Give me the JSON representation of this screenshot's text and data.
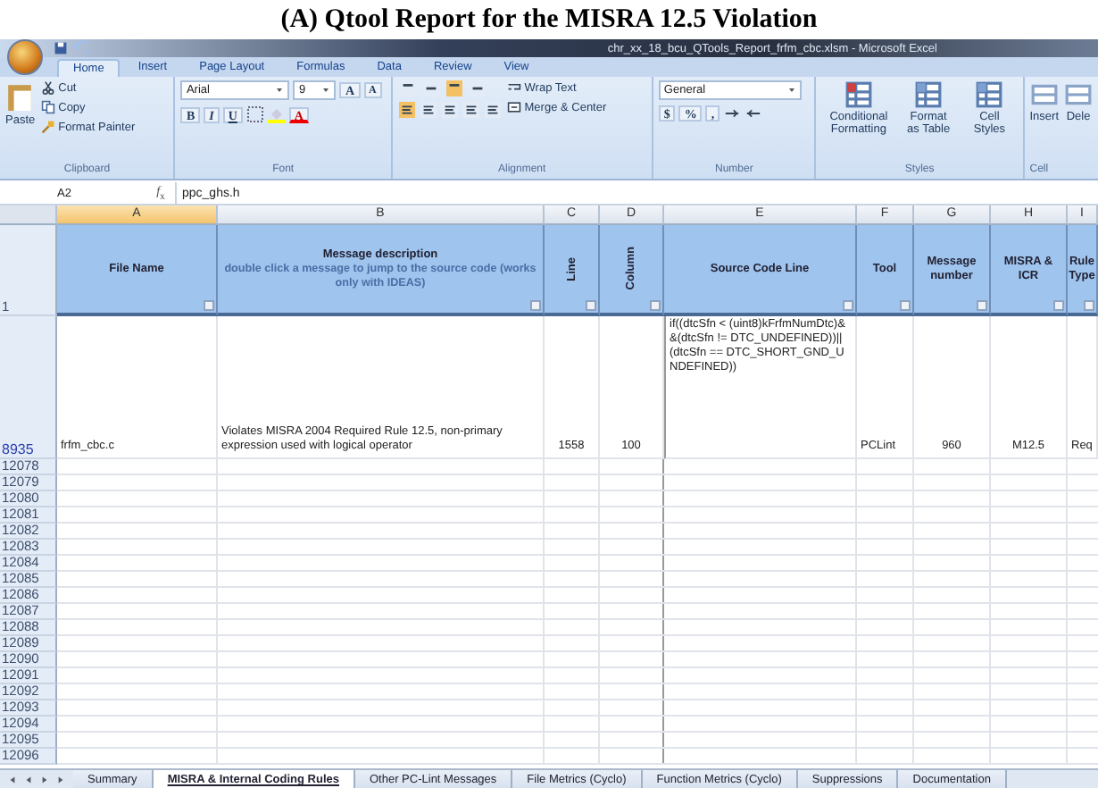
{
  "caption": "(A) Qtool Report for the MISRA 12.5 Violation",
  "window": {
    "title": "chr_xx_18_bcu_QTools_Report_frfm_cbc.xlsm - Microsoft Excel"
  },
  "ribbon": {
    "tabs": [
      {
        "label": "Home",
        "selected": true
      },
      {
        "label": "Insert",
        "selected": false
      },
      {
        "label": "Page Layout",
        "selected": false
      },
      {
        "label": "Formulas",
        "selected": false
      },
      {
        "label": "Data",
        "selected": false
      },
      {
        "label": "Review",
        "selected": false
      },
      {
        "label": "View",
        "selected": false
      }
    ],
    "clipboard": {
      "paste": "Paste",
      "cut": "Cut",
      "copy": "Copy",
      "format_painter": "Format Painter",
      "label": "Clipboard"
    },
    "font": {
      "name": "Arial",
      "size": "9",
      "grow": "A",
      "shrink": "A",
      "styles": [
        "B",
        "I",
        "U"
      ],
      "color_button": "A",
      "label": "Font"
    },
    "alignment": {
      "wrap_text": "Wrap Text",
      "merge": "Merge & Center",
      "label": "Alignment"
    },
    "number": {
      "format": "General",
      "symbols": [
        "$",
        "%",
        ","
      ],
      "label": "Number"
    },
    "styles": {
      "buttons": [
        "Conditional Formatting",
        "Format as Table",
        "Cell Styles"
      ],
      "label": "Styles"
    },
    "cells": {
      "buttons": [
        "Insert",
        "Dele"
      ],
      "label": "Cell"
    }
  },
  "formula_bar": {
    "cell_ref": "A2",
    "fx": "*f*$_{x}$",
    "value": "ppc_ghs.h"
  },
  "sheet": {
    "header_row": "1",
    "columns": [
      {
        "letter": "A",
        "heading": "File Name",
        "selected": true,
        "kind": "plain",
        "centered": false
      },
      {
        "letter": "B",
        "heading": "Message description",
        "note": "double click a message to jump to the source code (works only with IDEAS)",
        "selected": false,
        "kind": "plain",
        "centered": false
      },
      {
        "letter": "C",
        "heading": "Line",
        "selected": false,
        "kind": "vertical",
        "centered": true
      },
      {
        "letter": "D",
        "heading": "Column",
        "selected": false,
        "kind": "vertical",
        "centered": true
      },
      {
        "letter": "E",
        "heading": "Source Code Line",
        "selected": false,
        "kind": "plain",
        "centered": false
      },
      {
        "letter": "F",
        "heading": "Tool",
        "selected": false,
        "kind": "plain",
        "centered": false
      },
      {
        "letter": "G",
        "heading": "Message number",
        "selected": false,
        "kind": "plain",
        "centered": true
      },
      {
        "letter": "H",
        "heading": "MISRA & ICR",
        "selected": false,
        "kind": "plain",
        "centered": true
      },
      {
        "letter": "I",
        "heading": "Rule Type",
        "selected": false,
        "kind": "plain",
        "centered": false
      }
    ],
    "rows": [
      {
        "number": "8935",
        "cells": [
          "frfm_cbc.c",
          "Violates MISRA 2004 Required Rule 12.5, non-primary expression used with logical operator",
          "1558",
          "100",
          "if((dtcSfn < (uint8)kFrfmNumDtc)&&(dtcSfn != DTC_UNDEFINED))||(dtcSfn == DTC_SHORT_GND_UNDEFINED))",
          "PCLint",
          "960",
          "M12.5",
          "Req"
        ]
      }
    ],
    "empty_rows": [
      "12078",
      "12079",
      "12080",
      "12081",
      "12082",
      "12083",
      "12084",
      "12085",
      "12086",
      "12087",
      "12088",
      "12089",
      "12090",
      "12091",
      "12092",
      "12093",
      "12094",
      "12095",
      "12096"
    ]
  },
  "sheet_tabs": [
    {
      "label": "Summary",
      "selected": false
    },
    {
      "label": "MISRA & Internal Coding Rules",
      "selected": true
    },
    {
      "label": "Other PC-Lint Messages",
      "selected": false
    },
    {
      "label": "File Metrics (Cyclo)",
      "selected": false
    },
    {
      "label": "Function Metrics (Cyclo)",
      "selected": false
    },
    {
      "label": "Suppressions",
      "selected": false
    },
    {
      "label": "Documentation",
      "selected": false
    }
  ]
}
